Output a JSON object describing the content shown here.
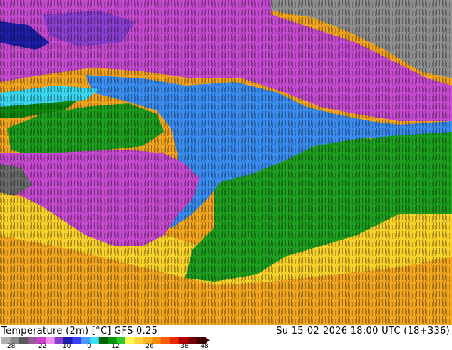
{
  "footer": {
    "title": "Temperature (2m) [°C] GFS 0.25",
    "datetime": "Su 15-02-2026 18:00 UTC (18+336)"
  },
  "legend": {
    "ticks": [
      "-28",
      "-22",
      "-10",
      "0",
      "12",
      "26",
      "38",
      "48"
    ],
    "colors": [
      "#b0b0b0",
      "#8a8a8a",
      "#5a5a5a",
      "#9b5aa0",
      "#d040d0",
      "#f090f0",
      "#8a3fd0",
      "#1e1ea8",
      "#3c3cff",
      "#4a9bff",
      "#3ce0ff",
      "#006400",
      "#089508",
      "#2ec82e",
      "#fffa50",
      "#ffd23c",
      "#ffb428",
      "#ff8c00",
      "#ff5a00",
      "#e62800",
      "#b40000",
      "#780000",
      "#3c0000"
    ]
  },
  "map": {
    "field": "2m temperature",
    "background_color": "#f2a61f"
  }
}
